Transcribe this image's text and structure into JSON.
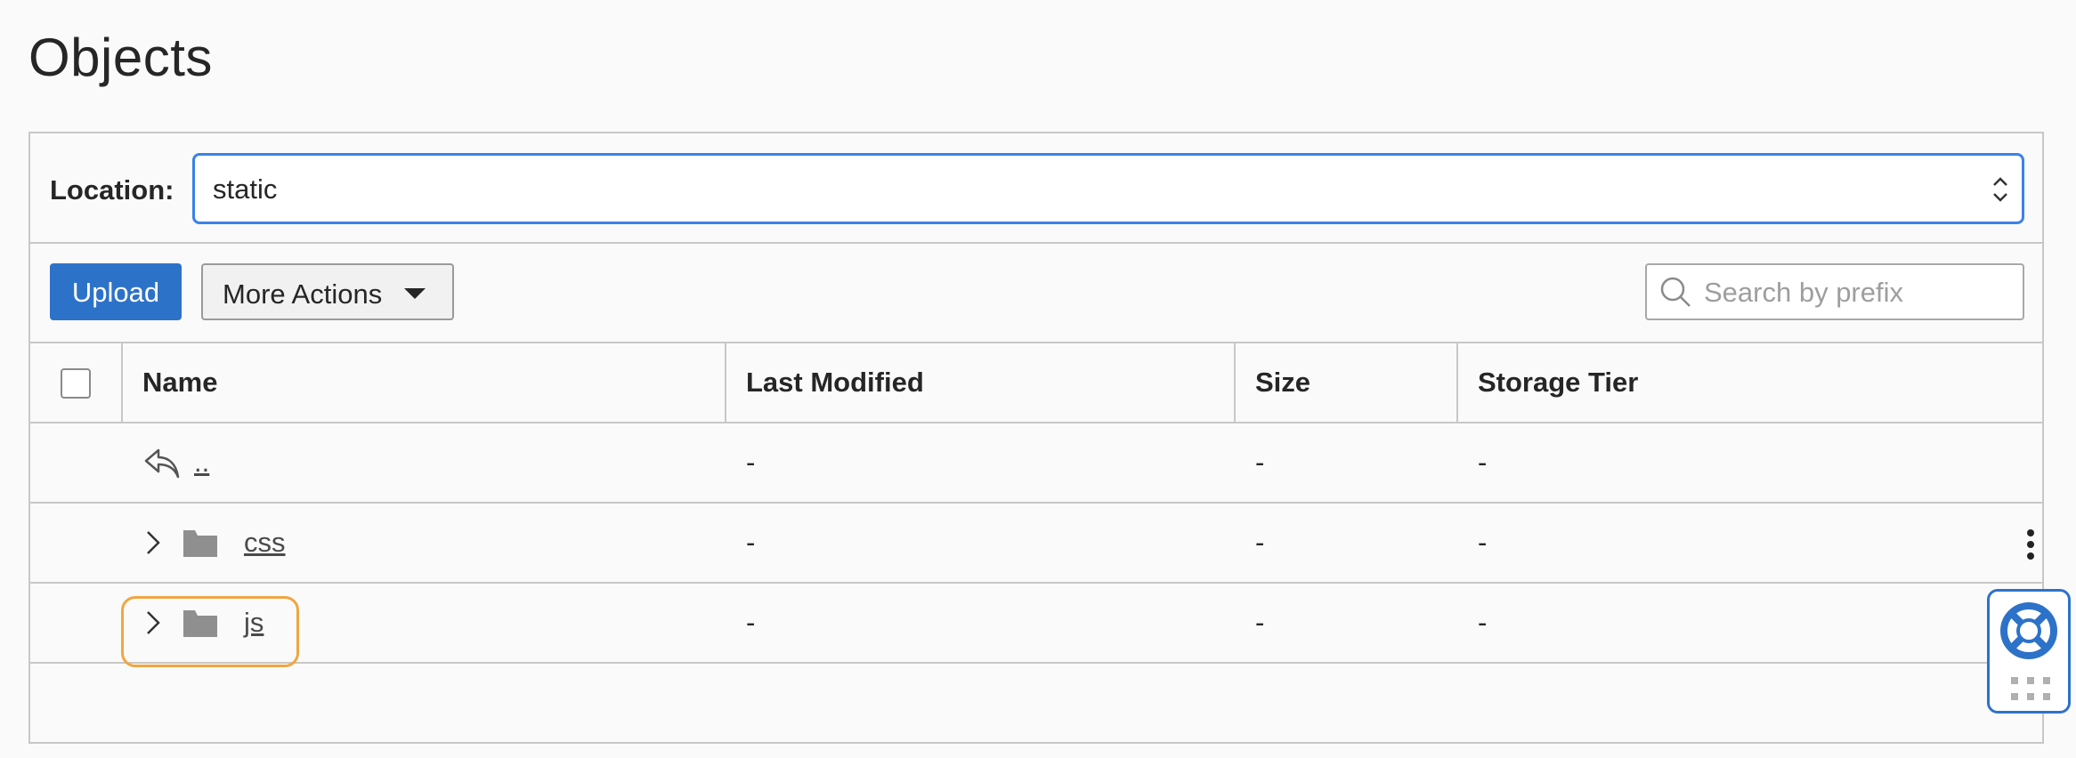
{
  "page": {
    "title": "Objects"
  },
  "location": {
    "label": "Location:",
    "value": "static"
  },
  "toolbar": {
    "upload_label": "Upload",
    "more_actions_label": "More Actions",
    "search_placeholder": "Search by prefix"
  },
  "table": {
    "columns": [
      "Name",
      "Last Modified",
      "Size",
      "Storage Tier"
    ],
    "rows": [
      {
        "name": "..",
        "type": "parent",
        "last_modified": "-",
        "size": "-",
        "storage_tier": "-"
      },
      {
        "name": "css",
        "type": "folder",
        "last_modified": "-",
        "size": "-",
        "storage_tier": "-"
      },
      {
        "name": "js",
        "type": "folder",
        "last_modified": "-",
        "size": "-",
        "storage_tier": "-"
      }
    ]
  },
  "colors": {
    "accent": "#2d72c9",
    "focus_border": "#3b82e6",
    "highlight": "#f0a640"
  },
  "icons": {
    "parent": "reply-arrow-icon",
    "folder": "folder-icon",
    "expand": "chevron-right-icon",
    "row_actions": "kebab-menu-icon",
    "search": "search-icon",
    "help": "lifebuoy-icon"
  }
}
